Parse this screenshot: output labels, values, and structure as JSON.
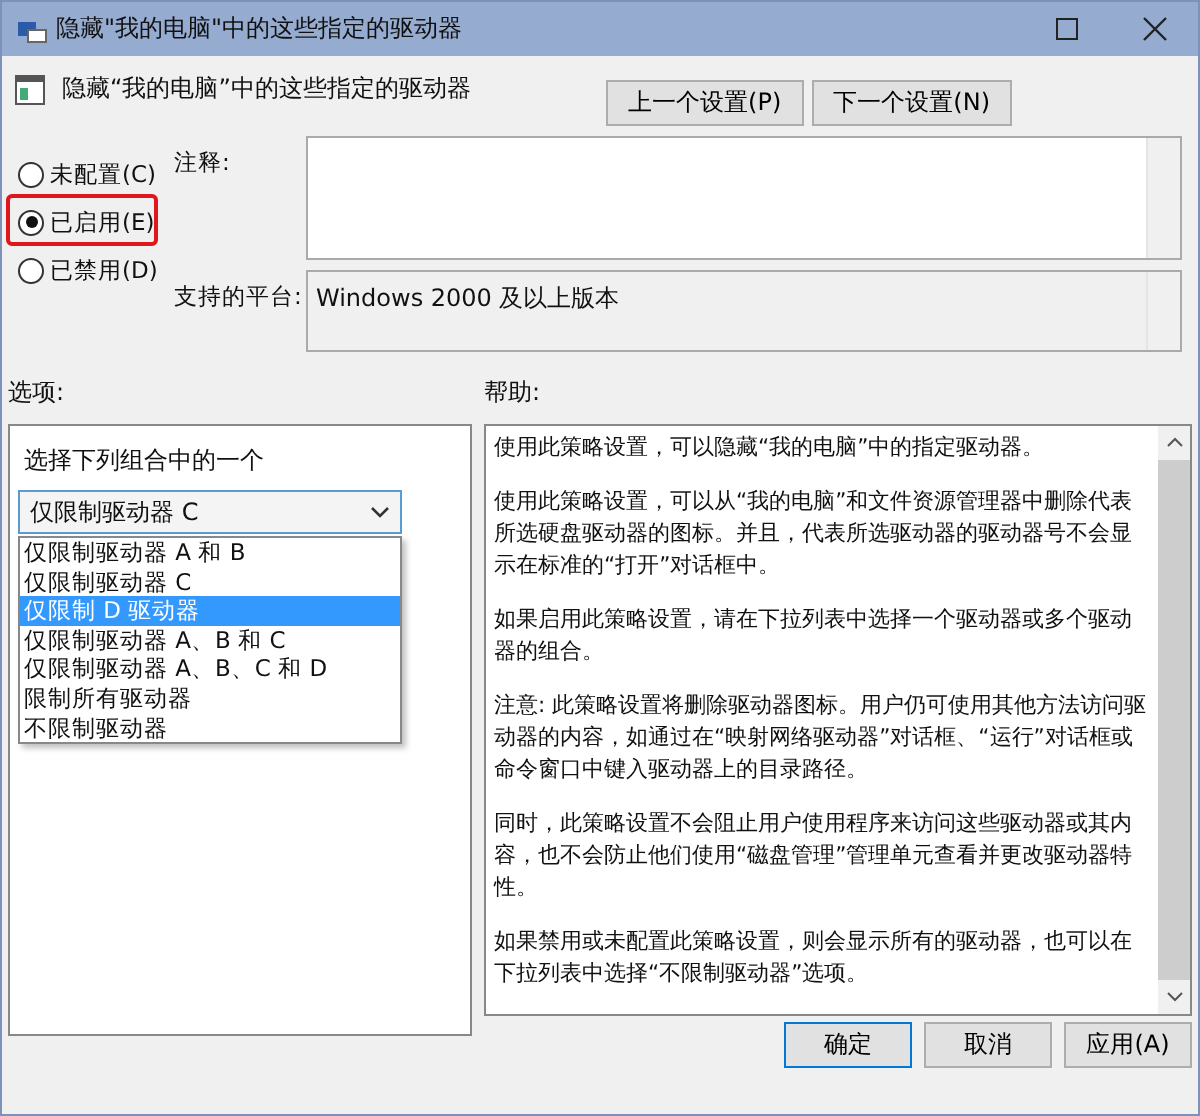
{
  "window": {
    "title": "隐藏\"我的电脑\"中的这些指定的驱动器"
  },
  "setting_name": "隐藏“我的电脑”中的这些指定的驱动器",
  "nav_buttons": [
    "上一个设置(P)",
    "下一个设置(N)"
  ],
  "state_options": [
    {
      "label": "未配置(C)",
      "selected": false,
      "highlighted": false
    },
    {
      "label": "已启用(E)",
      "selected": true,
      "highlighted": true
    },
    {
      "label": "已禁用(D)",
      "selected": false,
      "highlighted": false
    }
  ],
  "comment": {
    "label": "注释:"
  },
  "platform": {
    "label": "支持的平台:",
    "value": "Windows 2000 及以上版本"
  },
  "options": {
    "label": "选项:",
    "prompt": "选择下列组合中的一个",
    "combo_value": "仅限制驱动器 C",
    "dropdown_items": [
      {
        "label": "仅限制驱动器 A 和 B",
        "selected": false
      },
      {
        "label": "仅限制驱动器 C",
        "selected": false
      },
      {
        "label": "仅限制 D 驱动器",
        "selected": true
      },
      {
        "label": "仅限制驱动器 A、B 和 C",
        "selected": false
      },
      {
        "label": "仅限制驱动器 A、B、C 和 D",
        "selected": false
      },
      {
        "label": "限制所有驱动器",
        "selected": false
      },
      {
        "label": "不限制驱动器",
        "selected": false
      }
    ]
  },
  "help": {
    "label": "帮助:",
    "paragraphs": [
      "使用此策略设置，可以隐藏“我的电脑”中的指定驱动器。",
      "使用此策略设置，可以从“我的电脑”和文件资源管理器中删除代表所选硬盘驱动器的图标。并且，代表所选驱动器的驱动器号不会显示在标准的“打开”对话框中。",
      "如果启用此策略设置，请在下拉列表中选择一个驱动器或多个驱动器的组合。",
      "注意: 此策略设置将删除驱动器图标。用户仍可使用其他方法访问驱动器的内容，如通过在“映射网络驱动器”对话框、“运行”对话框或命令窗口中键入驱动器上的目录路径。",
      "同时，此策略设置不会阻止用户使用程序来访问这些驱动器或其内容，也不会防止他们使用“磁盘管理”管理单元查看并更改驱动器特性。",
      "如果禁用或未配置此策略设置，则会显示所有的驱动器，也可以在下拉列表中选择“不限制驱动器”选项。"
    ]
  },
  "footer_buttons": [
    "确定",
    "取消",
    "应用(A)"
  ]
}
